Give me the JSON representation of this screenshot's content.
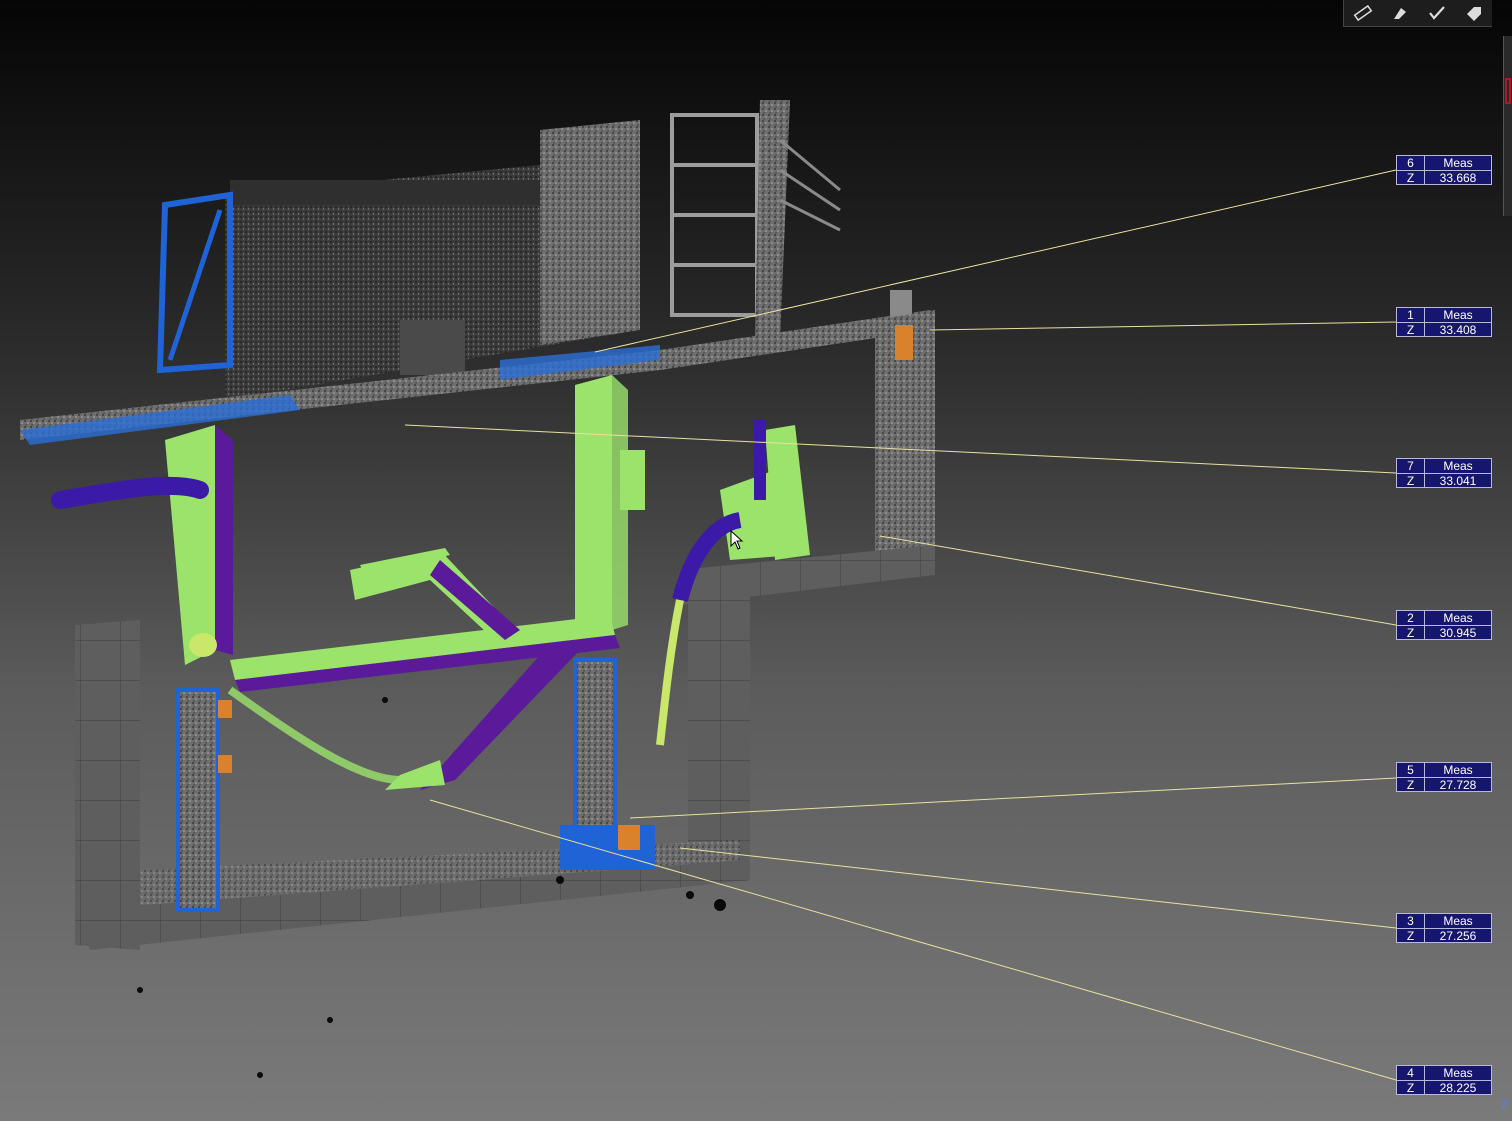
{
  "toolbar": {
    "tools": [
      {
        "name": "measure-distance-icon"
      },
      {
        "name": "measure-point-icon"
      },
      {
        "name": "measure-check-icon"
      },
      {
        "name": "measure-tag-icon"
      }
    ]
  },
  "measurements": [
    {
      "id": "6",
      "type": "Meas",
      "axis": "Z",
      "value": "33.668"
    },
    {
      "id": "1",
      "type": "Meas",
      "axis": "Z",
      "value": "33.408"
    },
    {
      "id": "7",
      "type": "Meas",
      "axis": "Z",
      "value": "33.041"
    },
    {
      "id": "2",
      "type": "Meas",
      "axis": "Z",
      "value": "30.945"
    },
    {
      "id": "5",
      "type": "Meas",
      "axis": "Z",
      "value": "27.728"
    },
    {
      "id": "3",
      "type": "Meas",
      "axis": "Z",
      "value": "27.256"
    },
    {
      "id": "4",
      "type": "Meas",
      "axis": "Z",
      "value": "28.225"
    }
  ],
  "axis_indicator": "Z",
  "colors": {
    "label_bg": "#17166e",
    "leader_line": "#e8e2a0",
    "pipe_green": "#9be36b",
    "pipe_purple": "#5a1a9a",
    "steel_blue": "#1f63d6",
    "point_cloud": "#8a8a8a",
    "orange_marker": "#d9822b"
  }
}
